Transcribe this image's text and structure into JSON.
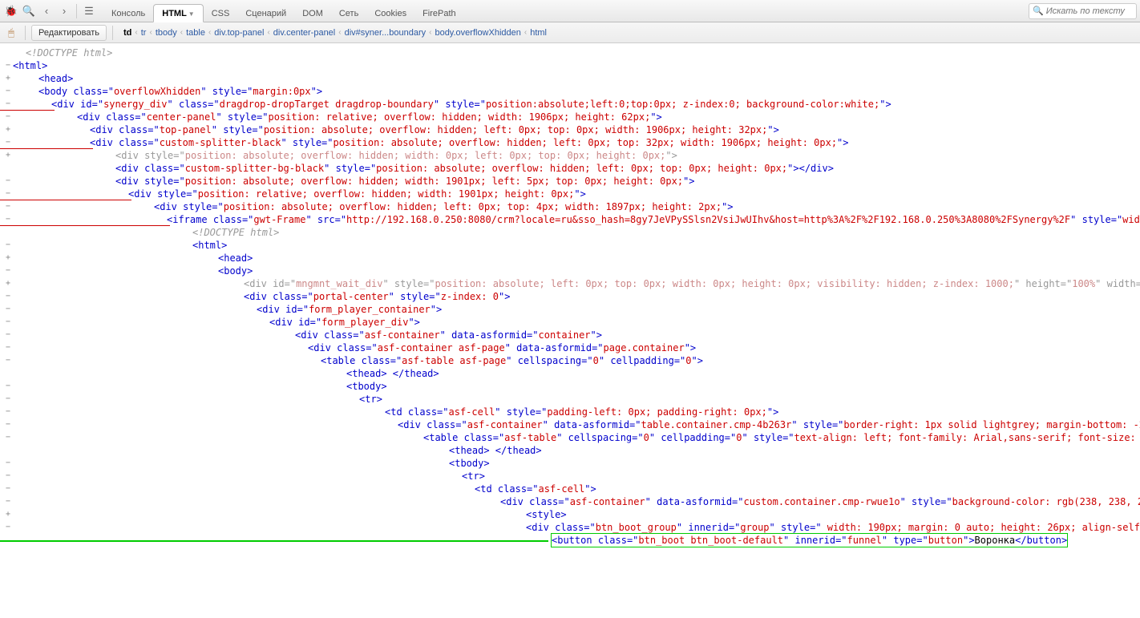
{
  "toolbar": {
    "tabs": [
      {
        "label": "Консоль"
      },
      {
        "label": "HTML",
        "active": true,
        "dropdown": true
      },
      {
        "label": "CSS"
      },
      {
        "label": "Сценарий"
      },
      {
        "label": "DOM"
      },
      {
        "label": "Сеть"
      },
      {
        "label": "Cookies"
      },
      {
        "label": "FirePath"
      }
    ],
    "search_placeholder": "Искать по тексту"
  },
  "subbar": {
    "edit_label": "Редактировать",
    "crumbs": [
      {
        "t": "td",
        "bold": true
      },
      {
        "t": "tr"
      },
      {
        "t": "tbody"
      },
      {
        "t": "table"
      },
      {
        "t": "div.top-panel"
      },
      {
        "t": "div.center-panel"
      },
      {
        "t": "div#syner...boundary"
      },
      {
        "t": "body.overflowXhidden"
      },
      {
        "t": "html"
      }
    ]
  },
  "code": [
    {
      "g": " ",
      "i": 1,
      "type": "doctype",
      "text": "<!DOCTYPE html>"
    },
    {
      "g": "−",
      "i": 0,
      "type": "tag",
      "tag": "html",
      "attrs": []
    },
    {
      "g": "+",
      "i": 2,
      "type": "tag",
      "tag": "head",
      "attrs": []
    },
    {
      "g": "−",
      "i": 2,
      "type": "tag",
      "tag": "body",
      "attrs": [
        [
          "class",
          "overflowXhidden"
        ],
        [
          "style",
          "margin:0px"
        ]
      ]
    },
    {
      "g": "−",
      "i": 3,
      "type": "tag",
      "tag": "div",
      "attrs": [
        [
          "id",
          "synergy_div"
        ],
        [
          "class",
          "dragdrop-dropTarget dragdrop-boundary"
        ],
        [
          "style",
          "position:absolute;left:0;top:0px; z-index:0; background-color:white;"
        ]
      ],
      "redbar": true
    },
    {
      "g": "−",
      "i": 5,
      "type": "tag",
      "tag": "div",
      "attrs": [
        [
          "class",
          "center-panel"
        ],
        [
          "style",
          "position: relative; overflow: hidden; width: 1906px; height: 62px;"
        ]
      ]
    },
    {
      "g": "+",
      "i": 6,
      "type": "tag",
      "tag": "div",
      "attrs": [
        [
          "class",
          "top-panel"
        ],
        [
          "style",
          "position: absolute; overflow: hidden; left: 0px; top: 0px; width: 1906px; height: 32px;"
        ]
      ]
    },
    {
      "g": "−",
      "i": 6,
      "type": "tag",
      "tag": "div",
      "attrs": [
        [
          "class",
          "custom-splitter-black"
        ],
        [
          "style",
          "position: absolute; overflow: hidden; left: 0px; top: 32px; width: 1906px; height: 0px;"
        ]
      ],
      "redbar": true
    },
    {
      "g": "+",
      "i": 8,
      "type": "tag",
      "tag": "div",
      "attrs": [
        [
          "style",
          "position: absolute; overflow: hidden; width: 0px; left: 0px; top: 0px; height: 0px;"
        ]
      ],
      "faded": true
    },
    {
      "g": " ",
      "i": 8,
      "type": "tag",
      "tag": "div",
      "attrs": [
        [
          "class",
          "custom-splitter-bg-black"
        ],
        [
          "style",
          "position: absolute; overflow: hidden; left: 0px; top: 0px; height: 0px;"
        ]
      ],
      "selfclose": "</div>"
    },
    {
      "g": "−",
      "i": 8,
      "type": "tag",
      "tag": "div",
      "attrs": [
        [
          "style",
          "position: absolute; overflow: hidden; width: 1901px; left: 5px; top: 0px; height: 0px;"
        ]
      ]
    },
    {
      "g": "−",
      "i": 9,
      "type": "tag",
      "tag": "div",
      "attrs": [
        [
          "style",
          "position: relative; overflow: hidden; width: 1901px; height: 0px;"
        ]
      ],
      "redbar": true
    },
    {
      "g": "−",
      "i": 11,
      "type": "tag",
      "tag": "div",
      "attrs": [
        [
          "style",
          "position: absolute; overflow: hidden; left: 0px; top: 4px; width: 1897px; height: 2px;"
        ]
      ]
    },
    {
      "g": "−",
      "i": 12,
      "type": "tag",
      "tag": "iframe",
      "attrs": [
        [
          "class",
          "gwt-Frame"
        ],
        [
          "src",
          "http://192.168.0.250:8080/crm?locale=ru&sso_hash=8gy7JeVPySSlsn2VsiJwUIhv&host=http%3A%2F%2F192.168.0.250%3A8080%2FSynergy%2F"
        ],
        [
          "style",
          "width: 1897px; height: 2px;"
        ]
      ],
      "redbar": true,
      "wrap": 14
    },
    {
      "g": " ",
      "i": 14,
      "type": "doctype",
      "text": "<!DOCTYPE html>"
    },
    {
      "g": "−",
      "i": 14,
      "type": "tag",
      "tag": "html",
      "attrs": []
    },
    {
      "g": "+",
      "i": 16,
      "type": "tag",
      "tag": "head",
      "attrs": []
    },
    {
      "g": "−",
      "i": 16,
      "type": "tag",
      "tag": "body",
      "attrs": []
    },
    {
      "g": "+",
      "i": 18,
      "type": "tag",
      "tag": "div",
      "attrs": [
        [
          "id",
          "mngmnt_wait_div"
        ],
        [
          "style",
          "position: absolute; left: 0px; top: 0px; width: 0px; height: 0px; visibility: hidden; z-index: 1000;"
        ],
        [
          "height",
          "100%"
        ],
        [
          "width",
          "100%"
        ]
      ],
      "faded": true,
      "wrap": 19
    },
    {
      "g": "−",
      "i": 18,
      "type": "tag",
      "tag": "div",
      "attrs": [
        [
          "class",
          "portal-center"
        ],
        [
          "style",
          "z-index: 0"
        ]
      ]
    },
    {
      "g": "−",
      "i": 19,
      "type": "tag",
      "tag": "div",
      "attrs": [
        [
          "id",
          "form_player_container"
        ]
      ]
    },
    {
      "g": "−",
      "i": 20,
      "type": "tag",
      "tag": "div",
      "attrs": [
        [
          "id",
          "form_player_div"
        ]
      ]
    },
    {
      "g": "−",
      "i": 22,
      "type": "tag",
      "tag": "div",
      "attrs": [
        [
          "class",
          "asf-container"
        ],
        [
          "data-asformid",
          "container"
        ]
      ]
    },
    {
      "g": "−",
      "i": 23,
      "type": "tag",
      "tag": "div",
      "attrs": [
        [
          "class",
          "asf-container asf-page"
        ],
        [
          "data-asformid",
          "page.container"
        ]
      ]
    },
    {
      "g": "−",
      "i": 24,
      "type": "tag",
      "tag": "table",
      "attrs": [
        [
          "class",
          "asf-table asf-page"
        ],
        [
          "cellspacing",
          "0"
        ],
        [
          "cellpadding",
          "0"
        ]
      ]
    },
    {
      "g": " ",
      "i": 26,
      "type": "raw",
      "html": "<span class='pun'>&lt;</span><span class='ct'>thead</span><span class='pun'>&gt; &lt;/</span><span class='ct'>thead</span><span class='pun'>&gt;</span>"
    },
    {
      "g": "−",
      "i": 26,
      "type": "tag",
      "tag": "tbody",
      "attrs": []
    },
    {
      "g": "−",
      "i": 27,
      "type": "tag",
      "tag": "tr",
      "attrs": []
    },
    {
      "g": "−",
      "i": 29,
      "type": "tag",
      "tag": "td",
      "attrs": [
        [
          "class",
          "asf-cell"
        ],
        [
          "style",
          "padding-left: 0px; padding-right: 0px;"
        ]
      ]
    },
    {
      "g": "−",
      "i": 30,
      "type": "tag",
      "tag": "div",
      "attrs": [
        [
          "class",
          "asf-container"
        ],
        [
          "data-asformid",
          "table.container.cmp-4b263r"
        ],
        [
          "style",
          "border-right: 1px solid lightgrey; margin-bottom: -2px; height: 100%;"
        ]
      ],
      "wrap": 31
    },
    {
      "g": "−",
      "i": 32,
      "type": "tag",
      "tag": "table",
      "attrs": [
        [
          "class",
          "asf-table"
        ],
        [
          "cellspacing",
          "0"
        ],
        [
          "cellpadding",
          "0"
        ],
        [
          "style",
          "text-align: left; font-family: Arial,sans-serif; font-size: 12px;"
        ]
      ],
      "wrap": 33
    },
    {
      "g": " ",
      "i": 34,
      "type": "raw",
      "html": "<span class='pun'>&lt;</span><span class='ct'>thead</span><span class='pun'>&gt; &lt;/</span><span class='ct'>thead</span><span class='pun'>&gt;</span>"
    },
    {
      "g": "−",
      "i": 34,
      "type": "tag",
      "tag": "tbody",
      "attrs": []
    },
    {
      "g": "−",
      "i": 35,
      "type": "tag",
      "tag": "tr",
      "attrs": []
    },
    {
      "g": "−",
      "i": 36,
      "type": "tag",
      "tag": "td",
      "attrs": [
        [
          "class",
          "asf-cell"
        ]
      ]
    },
    {
      "g": "−",
      "i": 38,
      "type": "tag",
      "tag": "div",
      "attrs": [
        [
          "class",
          "asf-container"
        ],
        [
          "data-asformid",
          "custom.container.cmp-rwue1o"
        ],
        [
          "style",
          "background-color: rgb(238, 238, 238); height: 32px; margin-top: -2px;"
        ]
      ],
      "wrap": 39
    },
    {
      "g": "+",
      "i": 40,
      "type": "tag",
      "tag": "style",
      "attrs": []
    },
    {
      "g": "−",
      "i": 40,
      "type": "tag",
      "tag": "div",
      "attrs": [
        [
          "class",
          "btn_boot_group"
        ],
        [
          "innerid",
          "group"
        ],
        [
          "style",
          " width: 190px; margin: 0 auto; height: 26px; align-self: center; text-align: center; "
        ]
      ],
      "wrap": 41
    },
    {
      "g": " ",
      "i": 42,
      "type": "tag",
      "tag": "button",
      "attrs": [
        [
          "class",
          "btn_boot btn_boot-default"
        ],
        [
          "innerid",
          "funnel"
        ],
        [
          "type",
          "button"
        ]
      ],
      "text": "Воронка",
      "selfclose": "</button>",
      "highlight": "green",
      "greenbar": true
    }
  ]
}
